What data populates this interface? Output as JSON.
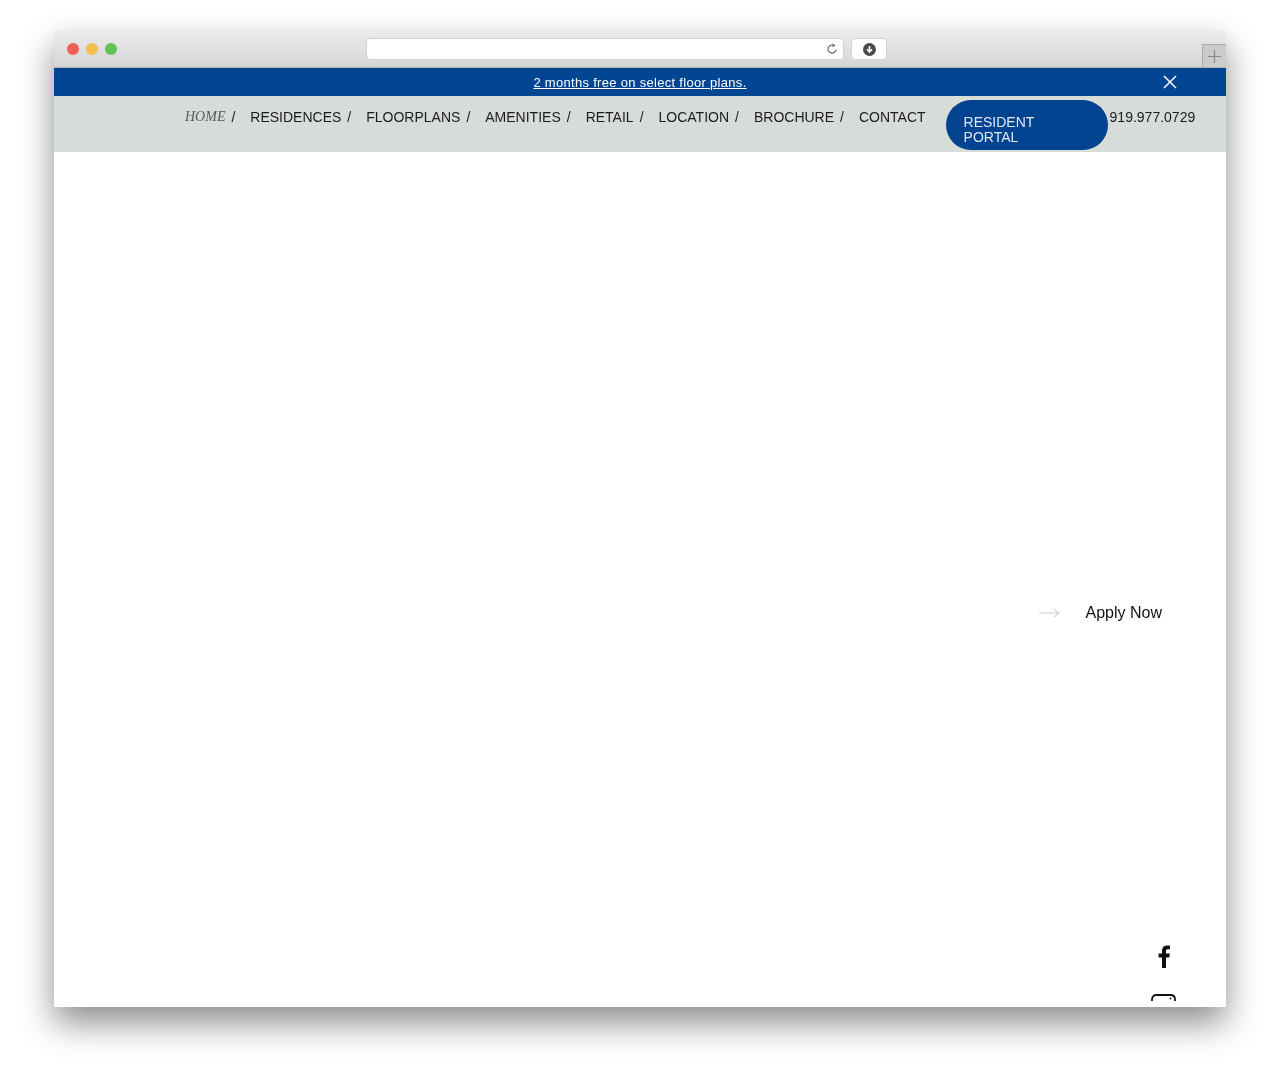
{
  "banner": {
    "text": "2 months free on select floor plans."
  },
  "nav": {
    "items": [
      {
        "label": "HOME",
        "separator": "/",
        "selected": true
      },
      {
        "label": "RESIDENCES",
        "separator": "/",
        "selected": false
      },
      {
        "label": "FLOORPLANS",
        "separator": "/",
        "selected": false
      },
      {
        "label": "AMENITIES",
        "separator": "/",
        "selected": false
      },
      {
        "label": "RETAIL",
        "separator": "/",
        "selected": false
      },
      {
        "label": "LOCATION",
        "separator": "/",
        "selected": false
      },
      {
        "label": "BROCHURE",
        "separator": "/",
        "selected": false
      },
      {
        "label": "CONTACT",
        "selected": false
      }
    ],
    "portal_button": "RESIDENT PORTAL",
    "phone": "919.977.0729"
  },
  "hero": {
    "apply_link": "Apply Now"
  }
}
